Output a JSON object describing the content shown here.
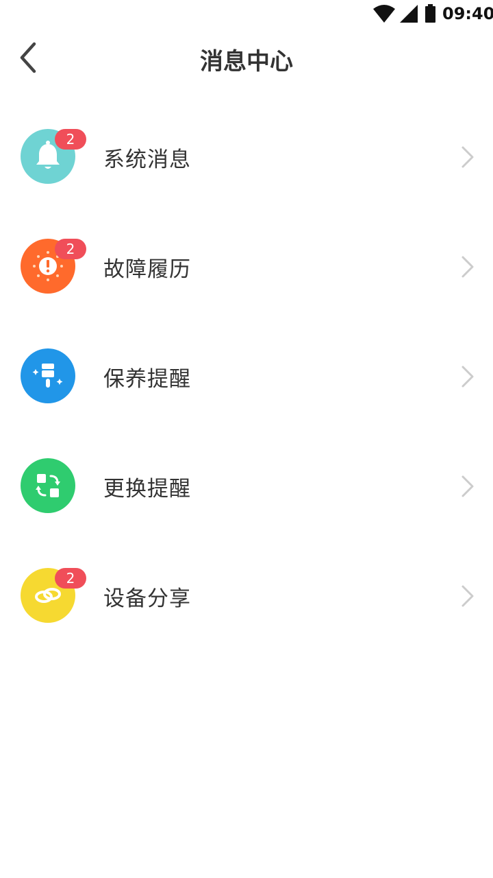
{
  "status_bar": {
    "time": "09:40",
    "icons": [
      "wifi-icon",
      "cell-signal-icon",
      "battery-icon"
    ]
  },
  "header": {
    "title": "消息中心",
    "back_icon": "chevron-left-icon"
  },
  "items": [
    {
      "label": "系统消息",
      "badge": "2",
      "icon": "bell-icon",
      "color": "#6fd3d3"
    },
    {
      "label": "故障履历",
      "badge": "2",
      "icon": "alert-icon",
      "color": "#ff6a2c"
    },
    {
      "label": "保养提醒",
      "badge": "",
      "icon": "brush-icon",
      "color": "#2196e8"
    },
    {
      "label": "更换提醒",
      "badge": "",
      "icon": "swap-icon",
      "color": "#2fcc6f"
    },
    {
      "label": "设备分享",
      "badge": "2",
      "icon": "link-icon",
      "color": "#f6d931"
    }
  ],
  "colors": {
    "badge": "#f04e59",
    "text": "#333333",
    "chevron": "#cccccc"
  }
}
